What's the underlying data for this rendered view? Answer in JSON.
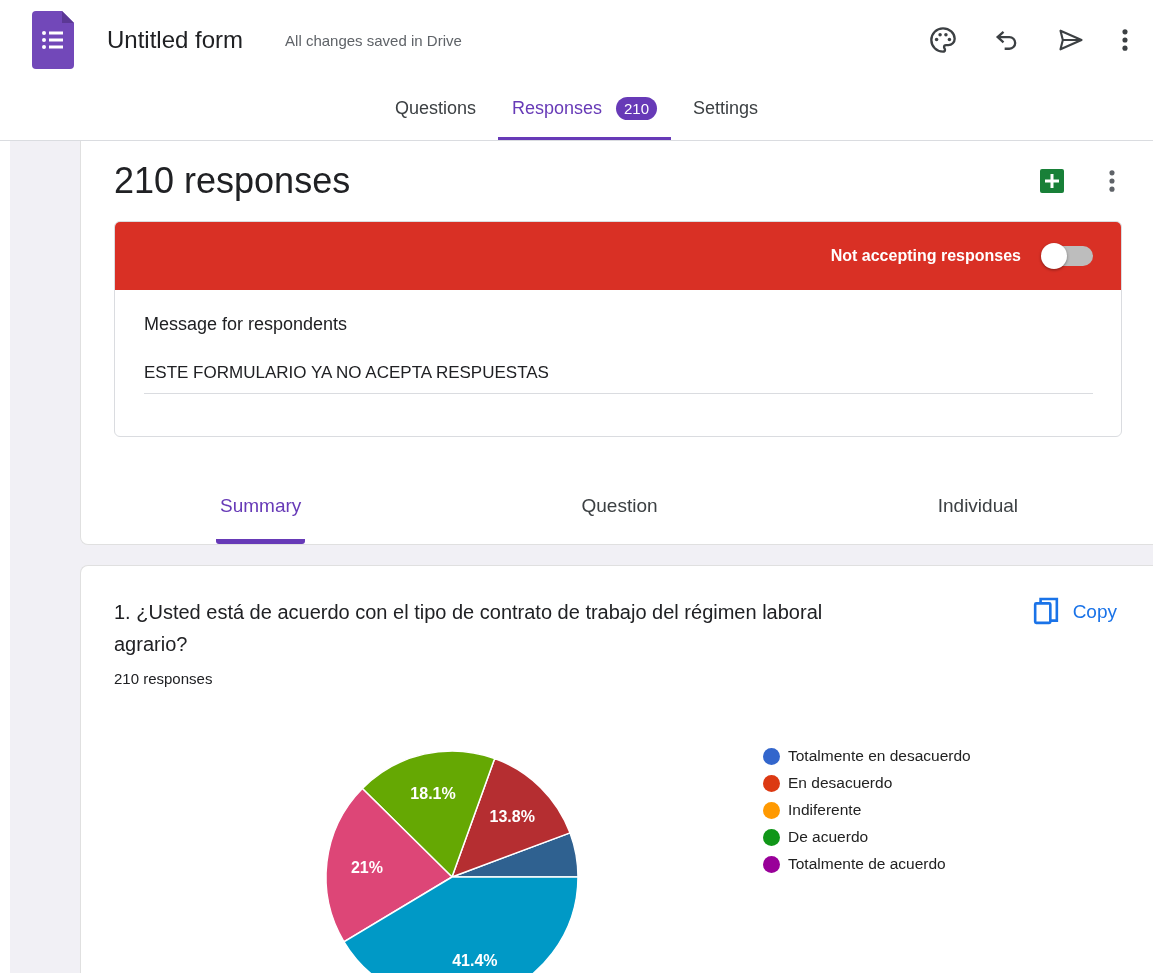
{
  "header": {
    "title": "Untitled form",
    "save_status": "All changes saved in Drive"
  },
  "tabs": [
    {
      "label": "Questions",
      "selected": false
    },
    {
      "label": "Responses",
      "selected": true,
      "badge": "210"
    },
    {
      "label": "Settings",
      "selected": false
    }
  ],
  "responses": {
    "title": "210 responses",
    "banner": {
      "label": "Not accepting responses",
      "on": false
    },
    "message_label": "Message for respondents",
    "message": "ESTE FORMULARIO YA NO ACEPTA RESPUESTAS"
  },
  "view_tabs": [
    {
      "label": "Summary",
      "selected": true
    },
    {
      "label": "Question",
      "selected": false
    },
    {
      "label": "Individual",
      "selected": false
    }
  ],
  "question": {
    "title": "1. ¿Usted está de acuerdo con el tipo de contrato de trabajo del régimen laboral agrario?",
    "count": "210 responses",
    "copy": "Copy",
    "chart_data": {
      "type": "pie",
      "values": [
        5.7,
        13.8,
        18.1,
        21,
        41.4
      ],
      "colors": [
        "#2f6190",
        "#b52e31",
        "#65a803",
        "#dd4677",
        "#0099c6"
      ],
      "value_labels": [
        null,
        "13.8%",
        "18.1%",
        "21%",
        "41.4%"
      ]
    },
    "legend": [
      {
        "label": "Totalmente en desacuerdo",
        "color": "#3366cc"
      },
      {
        "label": "En desacuerdo",
        "color": "#dc3912"
      },
      {
        "label": "Indiferente",
        "color": "#ff9900"
      },
      {
        "label": "De acuerdo",
        "color": "#109618"
      },
      {
        "label": "Totalmente de acuerdo",
        "color": "#990099"
      }
    ]
  }
}
